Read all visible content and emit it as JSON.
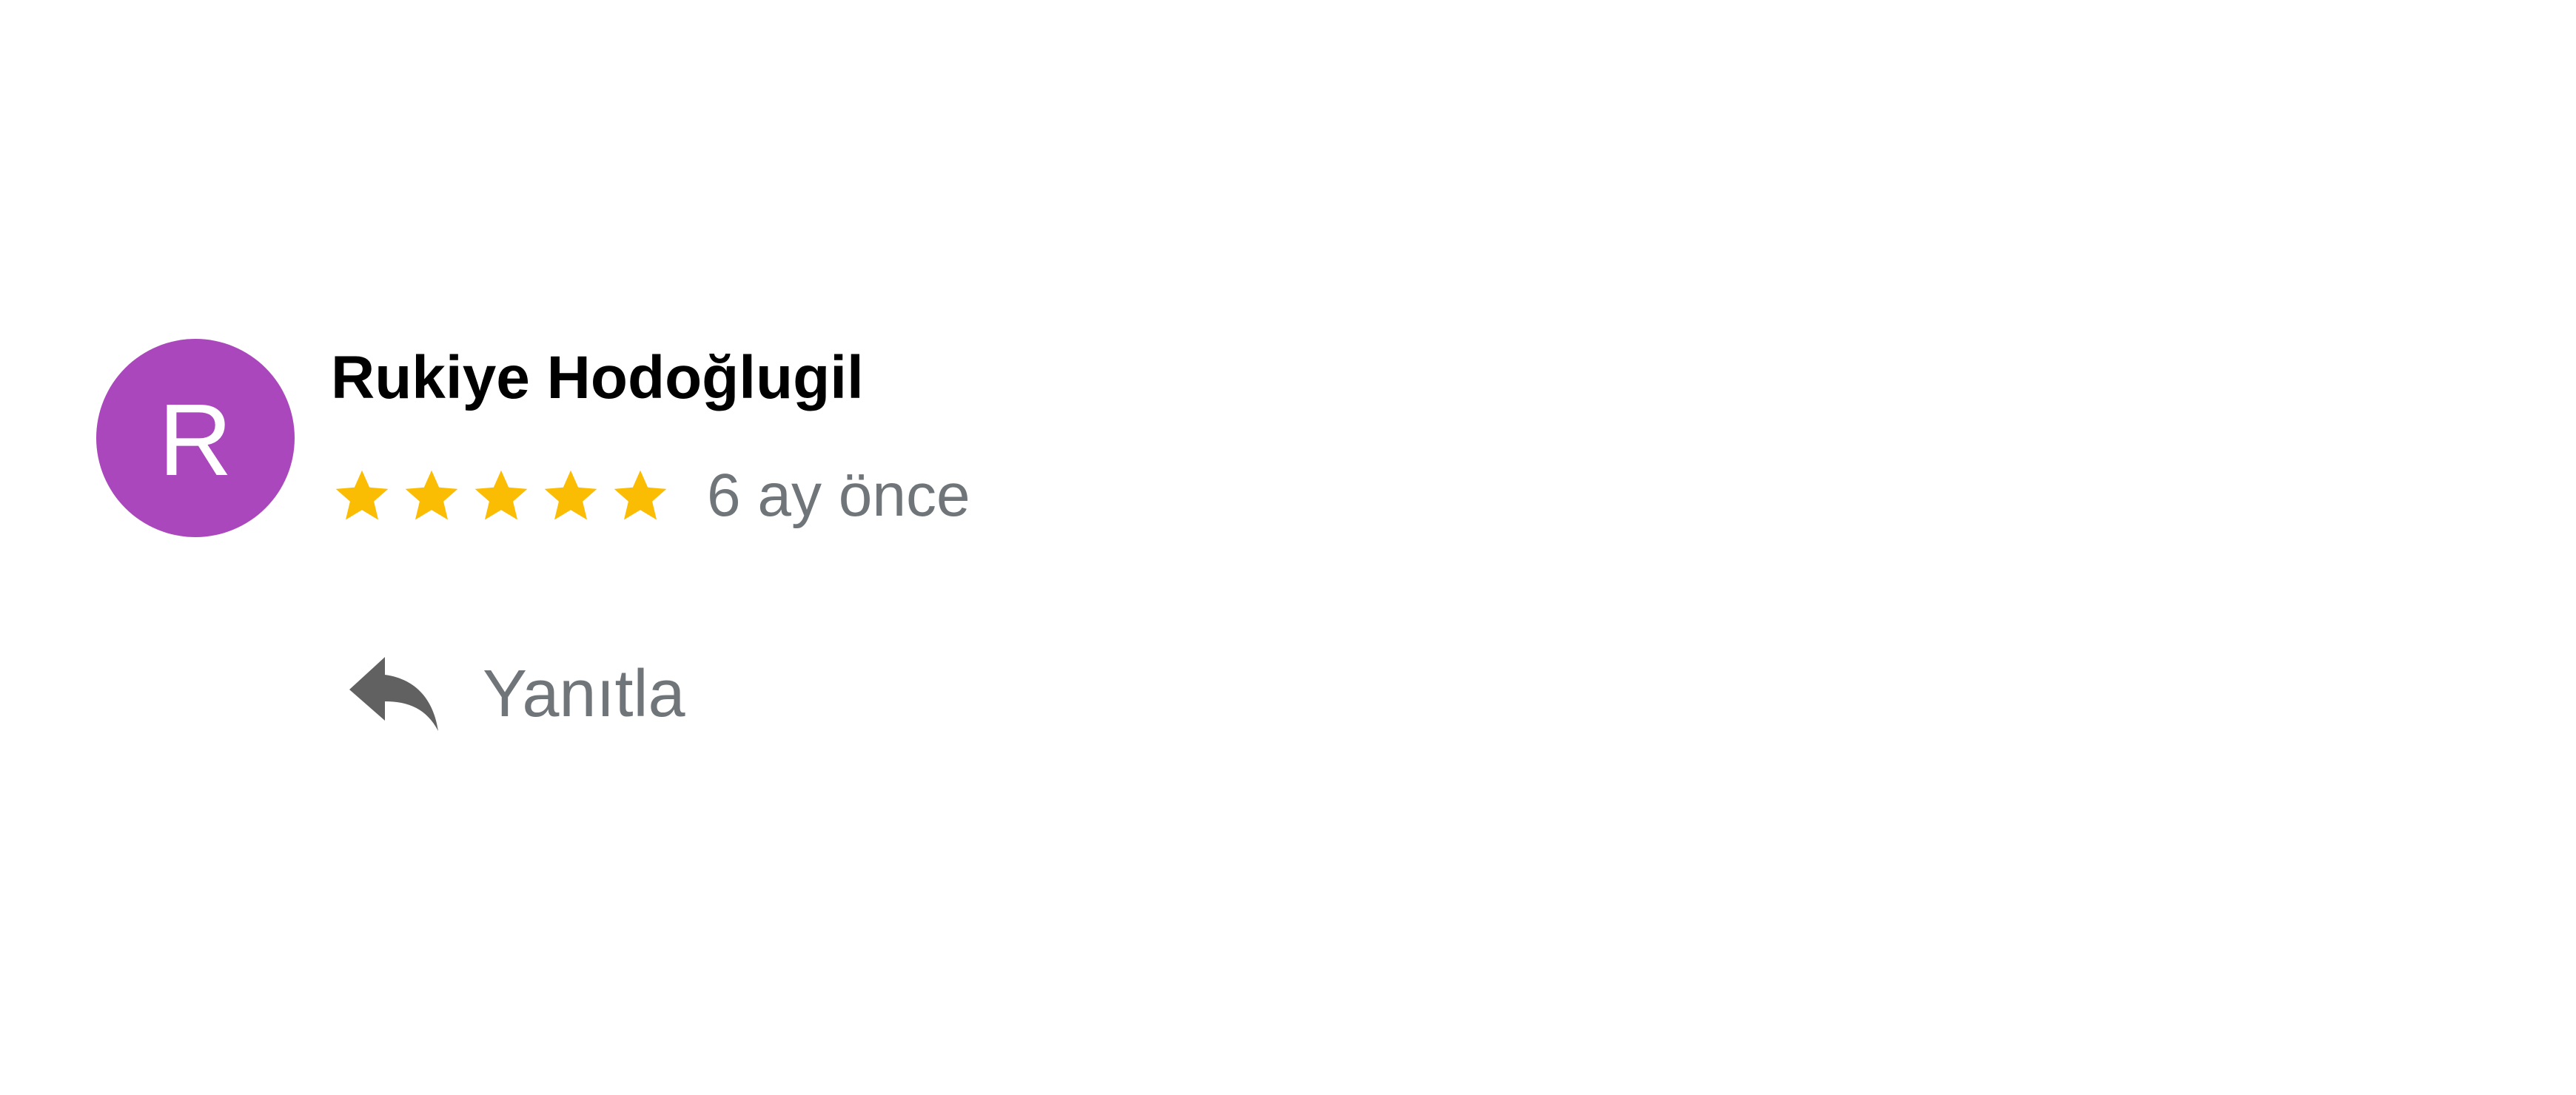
{
  "review": {
    "avatar_letter": "R",
    "avatar_color": "#ab47bc",
    "author_name": "Rukiye Hodoğlugil",
    "rating": 5,
    "rating_max": 5,
    "star_color": "#fbbc04",
    "time_ago": "6 ay önce",
    "reply_label": "Yanıtla",
    "reply_icon": "reply-icon"
  }
}
